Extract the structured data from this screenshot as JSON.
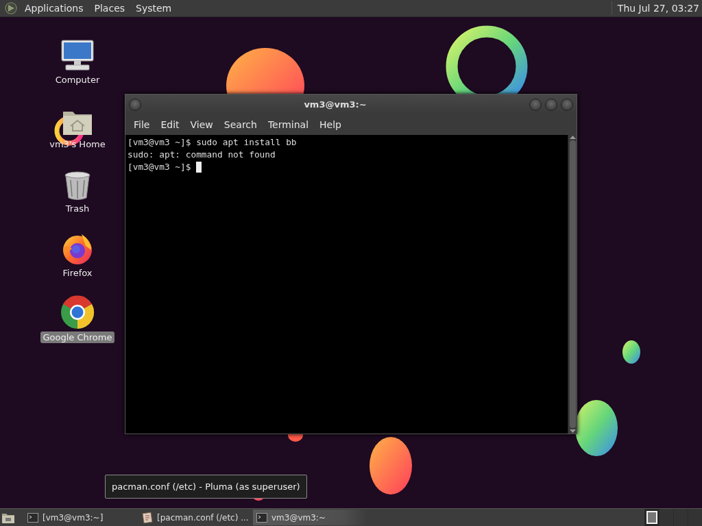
{
  "top_panel": {
    "menus": [
      {
        "label": "Applications"
      },
      {
        "label": "Places"
      },
      {
        "label": "System"
      }
    ],
    "clock": "Thu Jul 27, 03:27"
  },
  "desktop_icons": [
    {
      "kind": "computer",
      "label": "Computer",
      "selected": false
    },
    {
      "kind": "home",
      "label": "vm3's Home",
      "selected": false
    },
    {
      "kind": "trash",
      "label": "Trash",
      "selected": false
    },
    {
      "kind": "firefox",
      "label": "Firefox",
      "selected": false
    },
    {
      "kind": "chrome",
      "label": "Google Chrome",
      "selected": true
    }
  ],
  "terminal": {
    "title": "vm3@vm3:~",
    "menu": [
      "File",
      "Edit",
      "View",
      "Search",
      "Terminal",
      "Help"
    ],
    "lines": [
      {
        "text": "[vm3@vm3 ~]$ sudo apt install bb",
        "cursor": false
      },
      {
        "text": "sudo: apt: command not found",
        "cursor": false
      },
      {
        "text": "[vm3@vm3 ~]$",
        "cursor": true
      }
    ]
  },
  "tooltip": "pacman.conf (/etc) - Pluma (as superuser)",
  "taskbar": {
    "tasks": [
      {
        "kind": "terminal",
        "label": "[vm3@vm3:~]",
        "selected": false
      },
      {
        "kind": "editor",
        "label": "[pacman.conf (/etc) ...",
        "selected": false
      },
      {
        "kind": "terminal",
        "label": "vm3@vm3:~",
        "selected": true
      }
    ],
    "workspaces": [
      {
        "selected": true,
        "has_window": true
      },
      {
        "selected": false,
        "has_window": false
      },
      {
        "selected": false,
        "has_window": false
      },
      {
        "selected": false,
        "has_window": false
      }
    ]
  }
}
